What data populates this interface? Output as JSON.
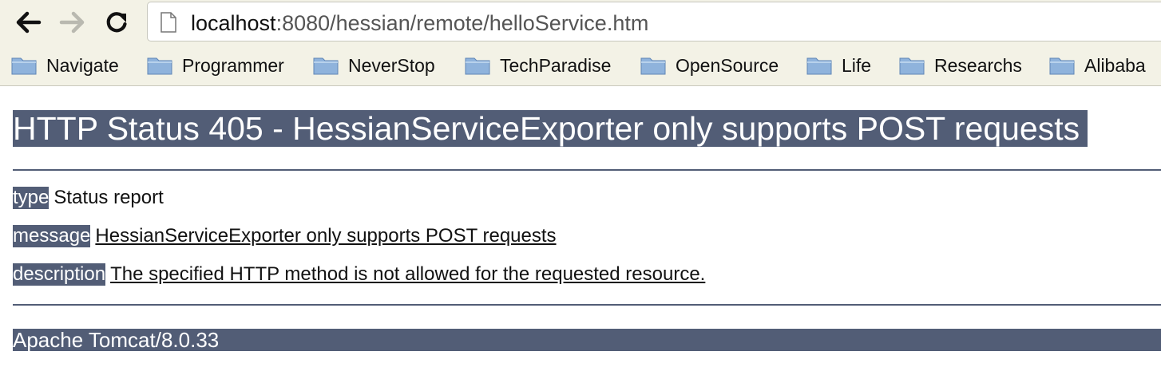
{
  "browser": {
    "url_host": "localhost",
    "url_rest": ":8080/hessian/remote/helloService.htm",
    "bookmarks": [
      {
        "label": "Navigate"
      },
      {
        "label": "Programmer"
      },
      {
        "label": "NeverStop"
      },
      {
        "label": "TechParadise"
      },
      {
        "label": "OpenSource"
      },
      {
        "label": "Life"
      },
      {
        "label": "Researchs"
      },
      {
        "label": "Alibaba"
      }
    ]
  },
  "page": {
    "title": "HTTP Status 405 - HessianServiceExporter only supports POST requests",
    "rows": [
      {
        "key": "type",
        "value": "Status report"
      },
      {
        "key": "message",
        "value": "HessianServiceExporter only supports POST requests"
      },
      {
        "key": "description",
        "value": "The specified HTTP method is not allowed for the requested resource."
      }
    ],
    "footer": "Apache Tomcat/8.0.33"
  },
  "colors": {
    "heading_bg": "#525d76",
    "toolbar_bg": "#f3f2e6"
  }
}
